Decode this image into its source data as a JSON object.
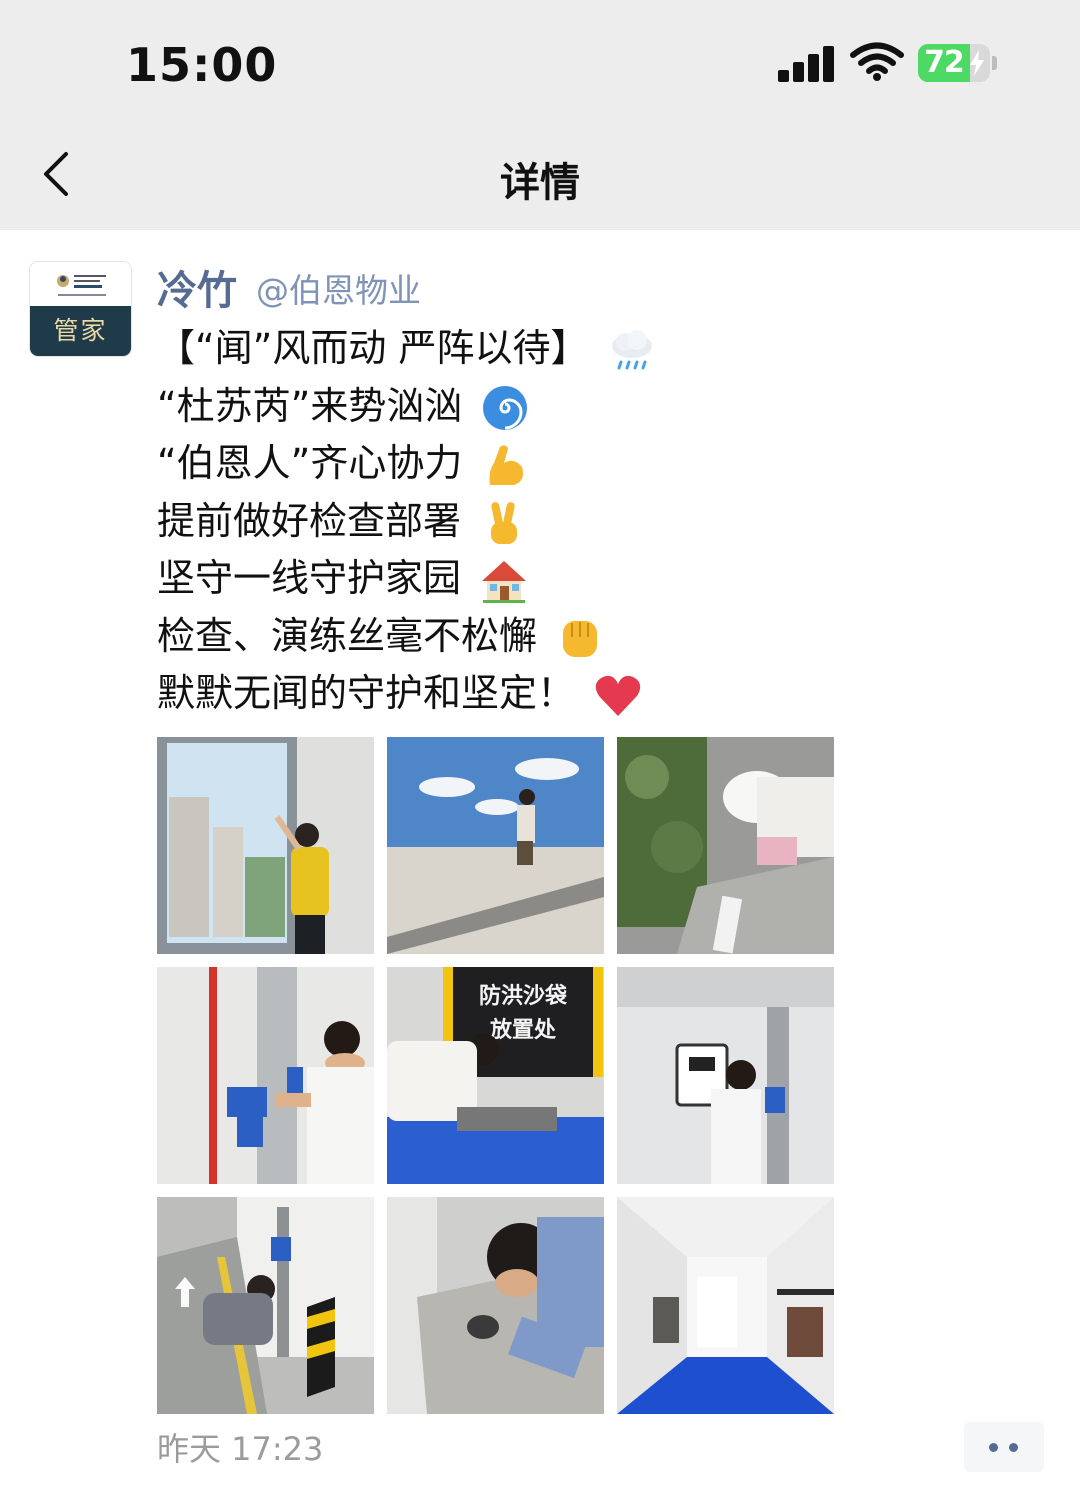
{
  "status_bar": {
    "time": "15:00",
    "battery_text": "72",
    "battery_level": 0.72,
    "icons": [
      "signal-icon",
      "wifi-icon",
      "battery-charging-icon"
    ]
  },
  "nav": {
    "back_icon": "chevron-left-icon",
    "title": "详情"
  },
  "post": {
    "avatar_text": "管家",
    "author_name": "冷竹",
    "author_handle": "@伯恩物业",
    "lines": [
      {
        "text": "【“闻”风而动 严阵以待】",
        "emoji": "cloud-rain-icon"
      },
      {
        "text": "“杜苏芮”来势汹汹",
        "emoji": "cyclone-icon"
      },
      {
        "text": "“伯恩人”齐心协力",
        "emoji": "flexed-biceps-icon"
      },
      {
        "text": "提前做好检查部署",
        "emoji": "victory-hand-icon"
      },
      {
        "text": "坚守一线守护家园",
        "emoji": "house-icon"
      },
      {
        "text": "检查、演练丝毫不松懈",
        "emoji": "raised-fist-icon"
      },
      {
        "text": "默默无闻的守护和坚定！",
        "emoji": "red-heart-icon"
      }
    ],
    "photos": [
      {
        "name": "photo-window-inspection"
      },
      {
        "name": "photo-drain-clearing"
      },
      {
        "name": "photo-curb-drain-check"
      },
      {
        "name": "photo-valve-inspection"
      },
      {
        "name": "photo-sandbag-station",
        "sign_line1": "防洪沙袋",
        "sign_line2": "放置处"
      },
      {
        "name": "photo-control-panel-check"
      },
      {
        "name": "photo-garage-drain-check"
      },
      {
        "name": "photo-floor-drain-check"
      },
      {
        "name": "photo-empty-room"
      }
    ],
    "timestamp": "昨天 17:23",
    "more_icon": "more-dots-icon"
  },
  "colors": {
    "name": "#566b94",
    "handle": "#7f92b8",
    "header_bg": "#ededed",
    "battery": "#4cd964"
  }
}
